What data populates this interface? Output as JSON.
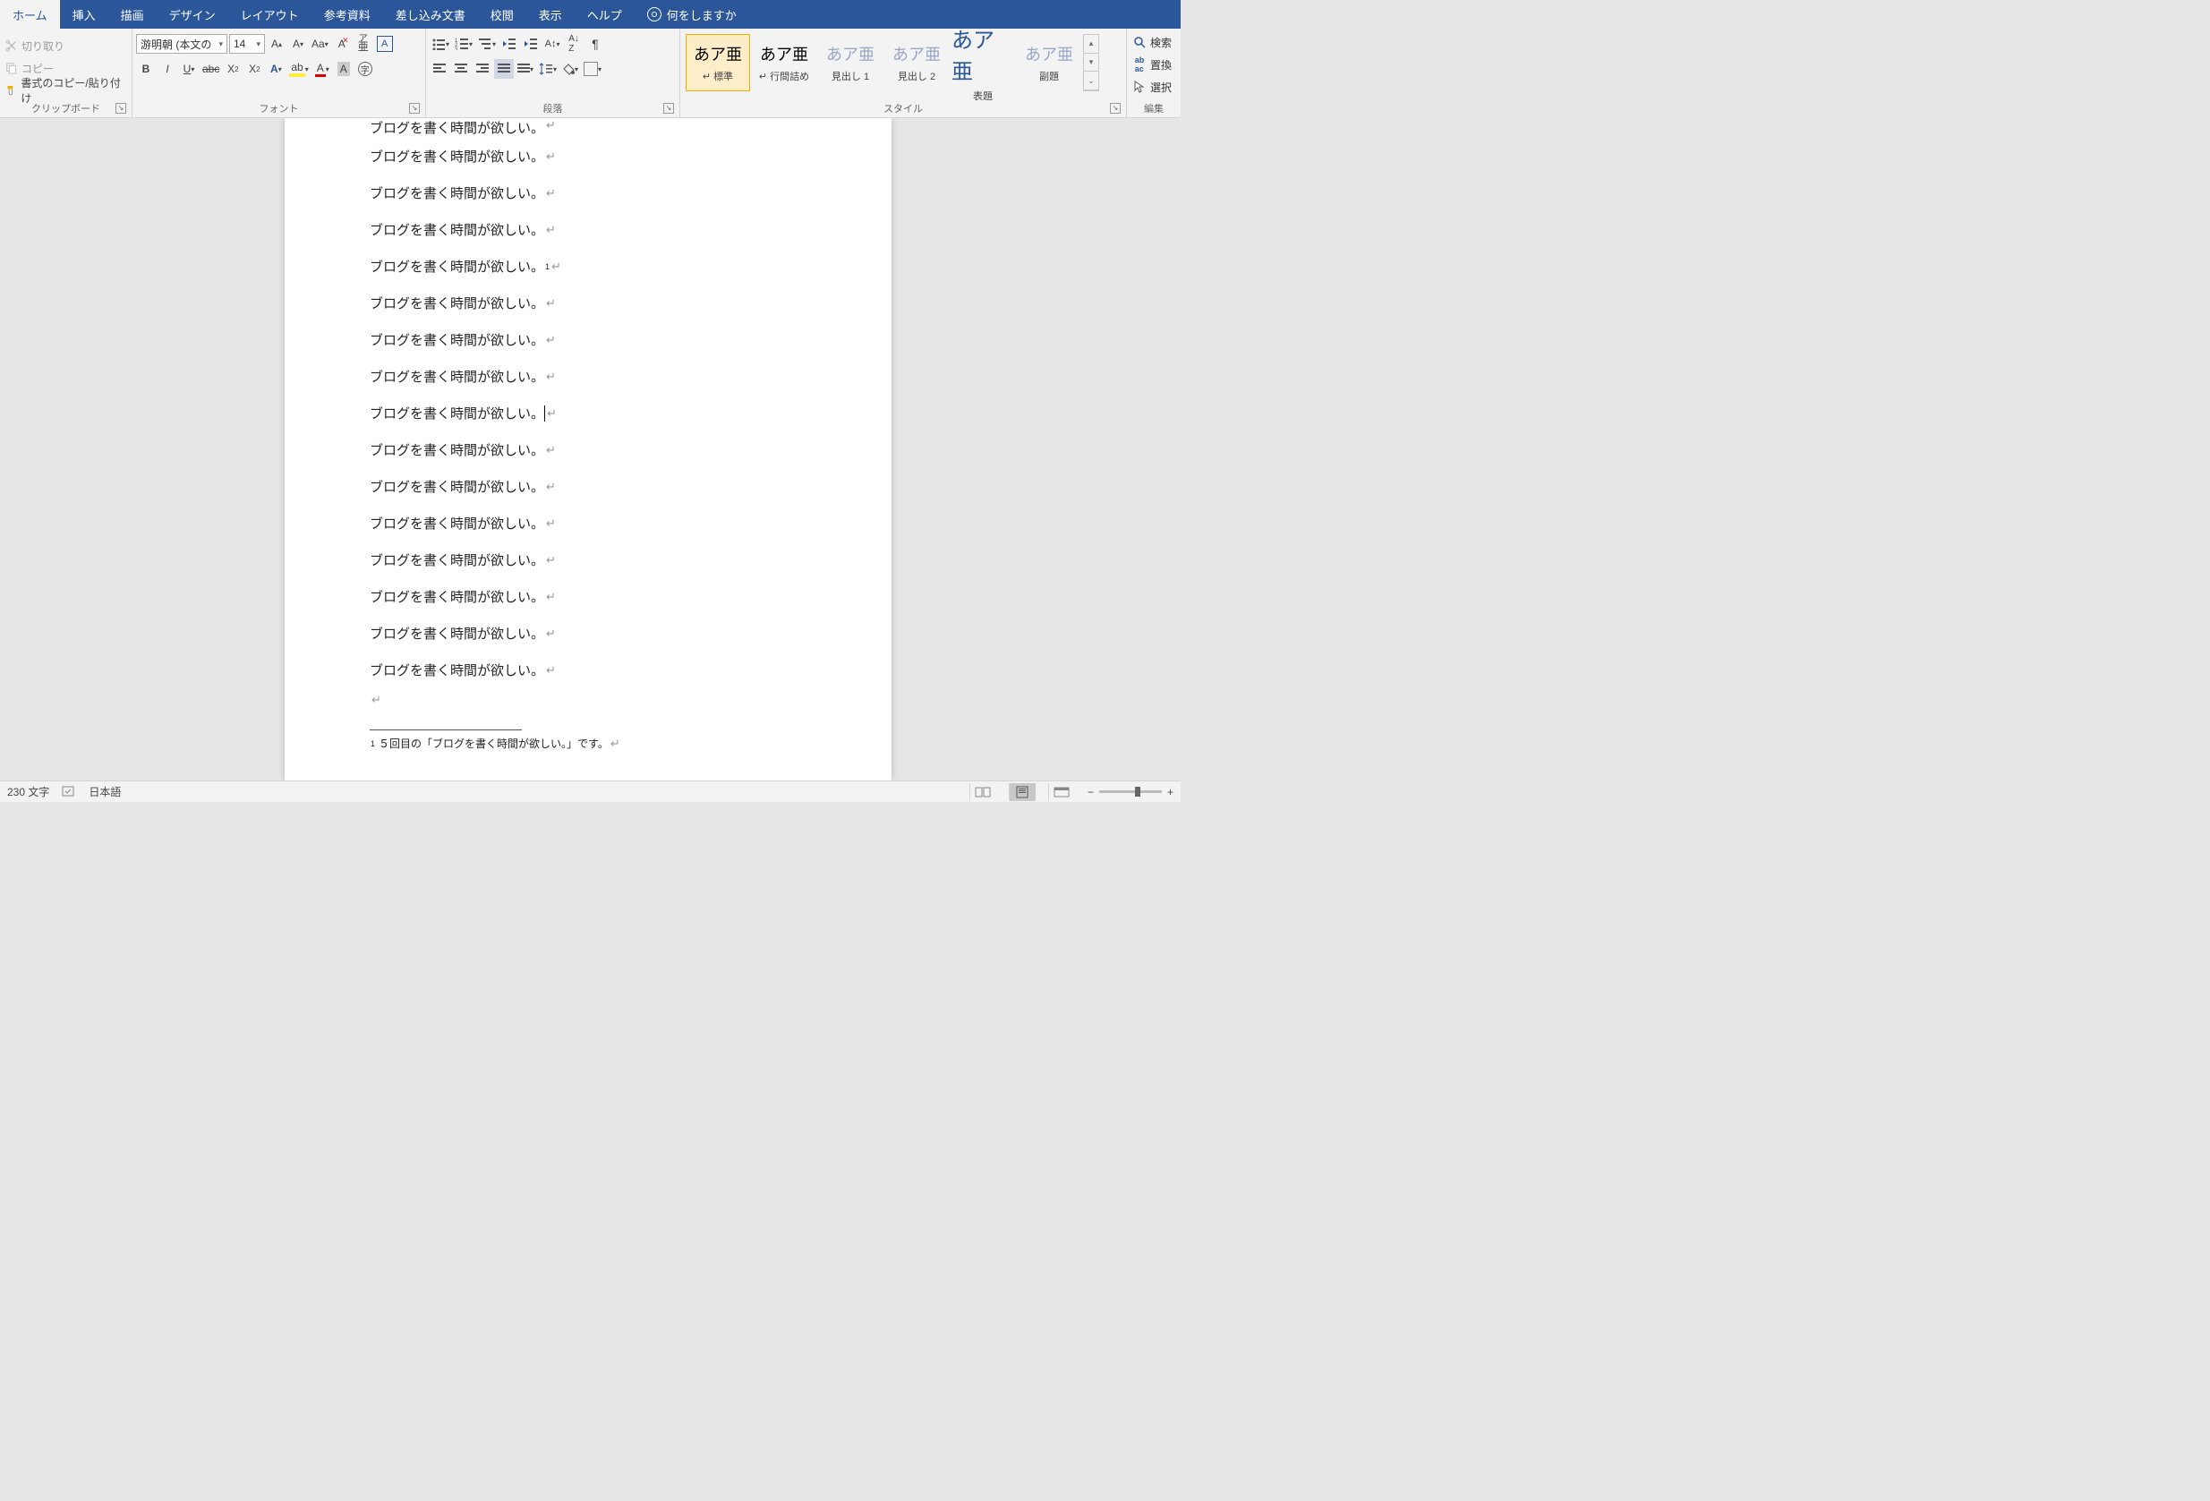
{
  "tabs": {
    "items": [
      "ホーム",
      "挿入",
      "描画",
      "デザイン",
      "レイアウト",
      "参考資料",
      "差し込み文書",
      "校閲",
      "表示",
      "ヘルプ"
    ],
    "tell_me": "何をしますか"
  },
  "clipboard": {
    "cut": "切り取り",
    "copy": "コピー",
    "paste": "書式のコピー/貼り付け",
    "label": "クリップボード"
  },
  "font": {
    "name": "游明朝 (本文の",
    "size": "14",
    "label": "フォント"
  },
  "paragraph": {
    "label": "段落"
  },
  "styles": {
    "label": "スタイル",
    "items": [
      {
        "preview": "あア亜",
        "name": "標準",
        "sel": true,
        "prefix": "↵ "
      },
      {
        "preview": "あア亜",
        "name": "行間詰め",
        "prefix": "↵ "
      },
      {
        "preview": "あア亜",
        "name": "見出し 1",
        "dim": true
      },
      {
        "preview": "あア亜",
        "name": "見出し 2",
        "dim": true
      },
      {
        "preview": "あア亜",
        "name": "表題",
        "big": true,
        "blue": true
      },
      {
        "preview": "あア亜",
        "name": "副題",
        "dim": true
      }
    ]
  },
  "editing": {
    "label": "編集",
    "find": "検索",
    "replace": "置換",
    "select": "選択"
  },
  "document": {
    "line": "ブログを書く時間が欲しい。",
    "footnote_ref": "1",
    "cursor_line_index": 8,
    "footnote": "５回目の「ブログを書く時間が欲しい。」です。"
  },
  "status": {
    "words": "230 文字",
    "lang": "日本語"
  }
}
